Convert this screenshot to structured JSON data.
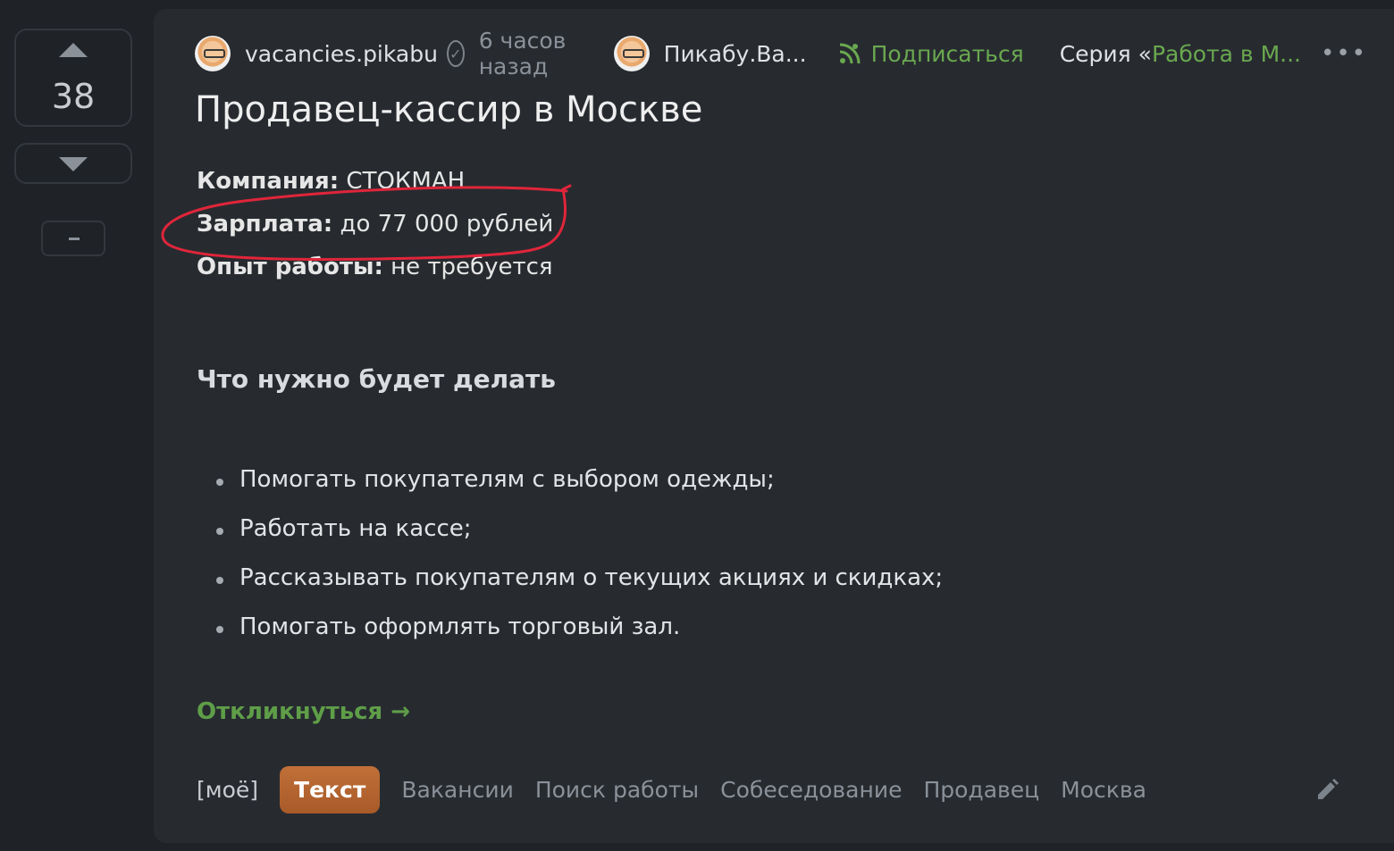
{
  "vote": {
    "count": "38",
    "minus": "–"
  },
  "post": {
    "author": "vacancies.pikabu",
    "time": "6 часов назад",
    "community": "Пикабу.Ва...",
    "subscribe_label": "Подписаться",
    "series_prefix": "Серия «",
    "series_link": "Работа в М...",
    "more": "•••",
    "title": "Продавец-кассир в Москве",
    "fields": [
      {
        "label": "Компания:",
        "value": " СТОКМАН"
      },
      {
        "label": "Зарплата:",
        "value": " до 77 000 рублей"
      },
      {
        "label": "Опыт работы:",
        "value": " не требуется"
      }
    ],
    "subheading": "Что нужно будет делать",
    "bullets": [
      "Помогать покупателям с выбором одежды;",
      "Работать на кассе;",
      "Рассказывать покупателям о текущих акциях и скидках;",
      "Помогать оформлять торговый зал."
    ],
    "respond": "Откликнуться →",
    "tags": [
      "[моё]",
      "Текст",
      "Вакансии",
      "Поиск работы",
      "Собеседование",
      "Продавец",
      "Москва"
    ]
  },
  "colors": {
    "accent_green": "#6aa84f",
    "tag_orange": "#b8662f",
    "annotation_red": "#e0253a"
  },
  "icons": {
    "upvote": "triangle-up-icon",
    "downvote": "triangle-down-icon",
    "verified": "check-circle-icon",
    "subscribe": "rss-person-icon",
    "edit": "pencil-icon"
  }
}
